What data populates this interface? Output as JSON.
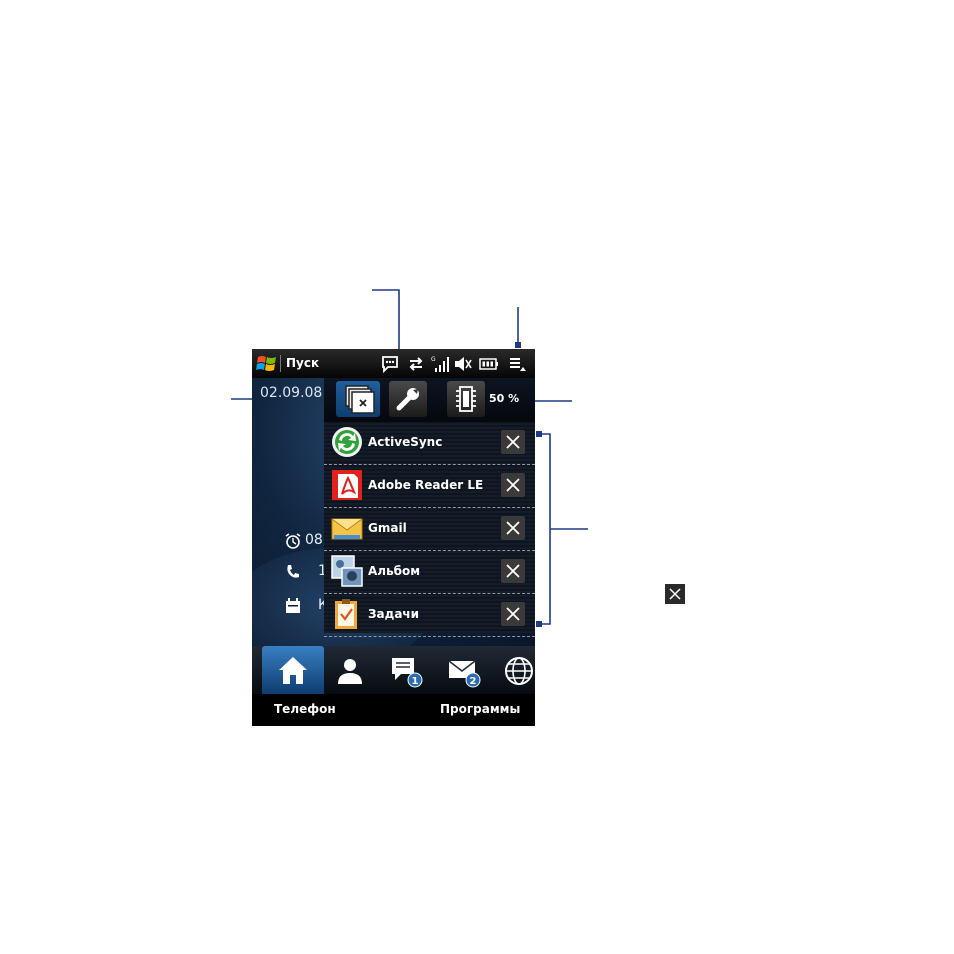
{
  "status_bar": {
    "start_label": "Пуск",
    "icons": [
      "start-logo-icon",
      "notification-icon",
      "sync-arrows-icon",
      "signal-strength-icon",
      "speaker-muted-icon",
      "battery-icon",
      "quick-menu-icon"
    ]
  },
  "home": {
    "date": "02.09.08",
    "alarm_text": "08",
    "call_text": "1",
    "calendar_text": "К"
  },
  "toolbar": {
    "memory_percent": "50 %",
    "icons": [
      "task-manager-icon",
      "tools-icon",
      "memory-chip-icon"
    ]
  },
  "tasks": [
    {
      "label": "ActiveSync",
      "icon": "activesync-icon"
    },
    {
      "label": "Adobe Reader LE",
      "icon": "adobe-reader-icon"
    },
    {
      "label": "Gmail",
      "icon": "mail-envelope-icon"
    },
    {
      "label": "Альбом",
      "icon": "album-icon"
    },
    {
      "label": "Задачи",
      "icon": "tasks-clipboard-icon"
    }
  ],
  "tabs": [
    {
      "icon": "home-icon",
      "badge": ""
    },
    {
      "icon": "contact-icon",
      "badge": ""
    },
    {
      "icon": "messages-icon",
      "badge": "1"
    },
    {
      "icon": "email-icon",
      "badge": "2"
    },
    {
      "icon": "internet-globe-icon",
      "badge": ""
    }
  ],
  "softkeys": {
    "left": "Телефон",
    "right": "Программы"
  },
  "colors": {
    "callout_line": "#1f3a8a",
    "active_tab": "#2b6cb0",
    "panel_bg": "#0e1520"
  }
}
